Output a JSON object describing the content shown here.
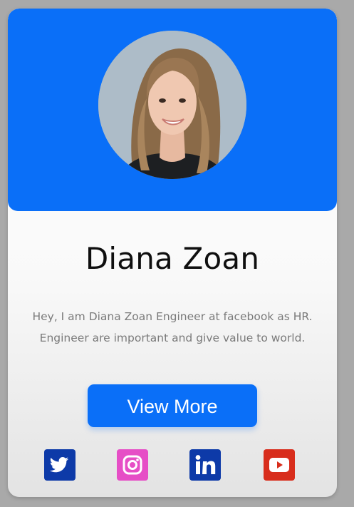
{
  "profile": {
    "name": "Diana Zoan",
    "bio": "Hey, I am Diana Zoan Engineer at facebook as HR. Engineer are important and give value to world.",
    "avatar_alt": "Diana Zoan"
  },
  "actions": {
    "view_more_label": "View More"
  },
  "social": [
    {
      "network": "Twitter",
      "icon": "twitter-icon",
      "color": "#0d3aa8"
    },
    {
      "network": "Instagram",
      "icon": "instagram-icon",
      "color": "#e64ec6"
    },
    {
      "network": "LinkedIn",
      "icon": "linkedin-icon",
      "color": "#0d3aa8"
    },
    {
      "network": "YouTube",
      "icon": "youtube-icon",
      "color": "#d82d1c"
    }
  ],
  "colors": {
    "accent": "#0a6ff8",
    "background": "#a9a9a9",
    "name_text": "#0f0f0f",
    "bio_text": "#7a7a7a"
  }
}
